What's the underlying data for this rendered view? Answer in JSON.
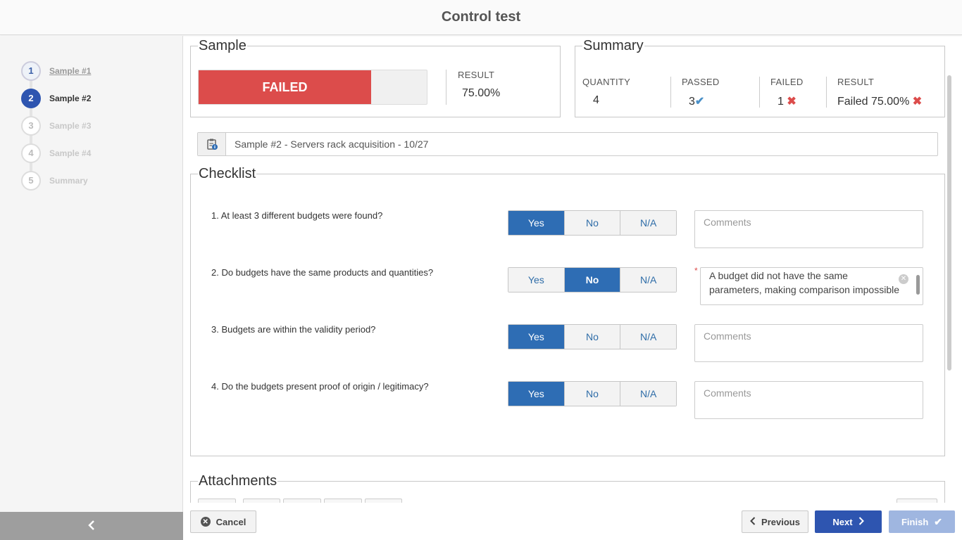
{
  "header": {
    "title": "Control test"
  },
  "steps": [
    {
      "number": "1",
      "label": "Sample #1"
    },
    {
      "number": "2",
      "label": "Sample #2"
    },
    {
      "number": "3",
      "label": "Sample #3"
    },
    {
      "number": "4",
      "label": "Sample #4"
    },
    {
      "number": "5",
      "label": "Summary"
    }
  ],
  "sample": {
    "legend": "Sample",
    "status": "FAILED",
    "result_label": "RESULT",
    "result_value": "75.00%"
  },
  "summary": {
    "legend": "Summary",
    "quantity_label": "QUANTITY",
    "quantity_value": "4",
    "passed_label": "PASSED",
    "passed_value": "3",
    "failed_label": "FAILED",
    "failed_value": "1",
    "result_label": "RESULT",
    "result_value": "Failed 75.00%"
  },
  "info": {
    "text": "Sample #2 - Servers rack acquisition - 10/27"
  },
  "checklist": {
    "legend": "Checklist",
    "options": {
      "yes": "Yes",
      "no": "No",
      "na": "N/A"
    },
    "comment_placeholder": "Comments",
    "questions": [
      {
        "text": "1. At least 3 different budgets were found?",
        "answer": "Yes"
      },
      {
        "text": "2. Do budgets have the same products and quantities?",
        "answer": "No",
        "comment": "A budget did not have the same parameters, making comparison impossible"
      },
      {
        "text": "3. Budgets are within the validity period?",
        "answer": "Yes"
      },
      {
        "text": "4. Do the budgets present proof of origin / legitimacy?",
        "answer": "Yes"
      }
    ]
  },
  "attachments": {
    "legend": "Attachments"
  },
  "footer": {
    "cancel": "Cancel",
    "previous": "Previous",
    "next": "Next",
    "finish": "Finish"
  },
  "colors": {
    "failed": "#dc4c4b",
    "primary": "#2e55b0",
    "selected": "#2e6db4",
    "finish_disabled": "#9fb6e0"
  }
}
